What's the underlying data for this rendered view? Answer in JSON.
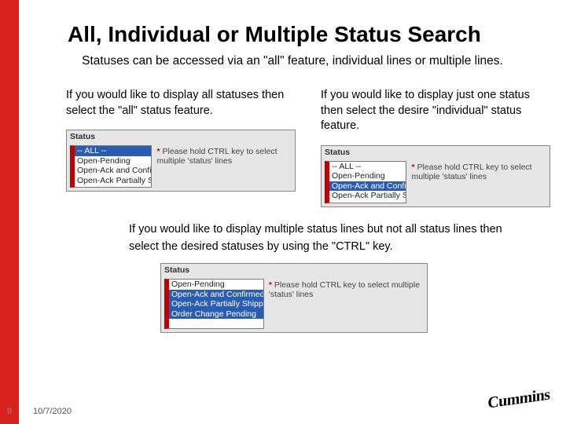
{
  "title": "All, Individual or Multiple Status Search",
  "subtitle": "Statuses can be accessed via an \"all\" feature, individual lines or multiple lines.",
  "left": {
    "text": "If you would like to display all statuses then select the \"all\" status feature.",
    "widget": {
      "label": "Status",
      "options": [
        "-- ALL --",
        "Open-Pending",
        "Open-Ack and Confirmed",
        "Open-Ack Partially Shipped"
      ],
      "selected_indices": [
        0
      ],
      "hint": "Please hold CTRL key to select multiple 'status' lines"
    }
  },
  "right": {
    "text": "If you would like to display just one status then select the desire \"individual\" status feature.",
    "widget": {
      "label": "Status",
      "options": [
        "-- ALL --",
        "Open-Pending",
        "Open-Ack and Confirmed",
        "Open-Ack Partially Shipped"
      ],
      "selected_indices": [
        2
      ],
      "hint": "Please hold CTRL key to select multiple 'status' lines"
    }
  },
  "mid": {
    "text": "If you would like to display multiple status lines but not all status lines then select the desired statuses by using the \"CTRL\" key.",
    "widget": {
      "label": "Status",
      "options": [
        "Open-Pending",
        "Open-Ack and Confirmed",
        "Open-Ack Partially Shipped",
        "Order Change Pending"
      ],
      "selected_indices": [
        1,
        2,
        3
      ],
      "hint": "Please hold CTRL key to select multiple 'status' lines"
    }
  },
  "footer": {
    "page": "9",
    "date": "10/7/2020"
  },
  "logo": "Cummins"
}
